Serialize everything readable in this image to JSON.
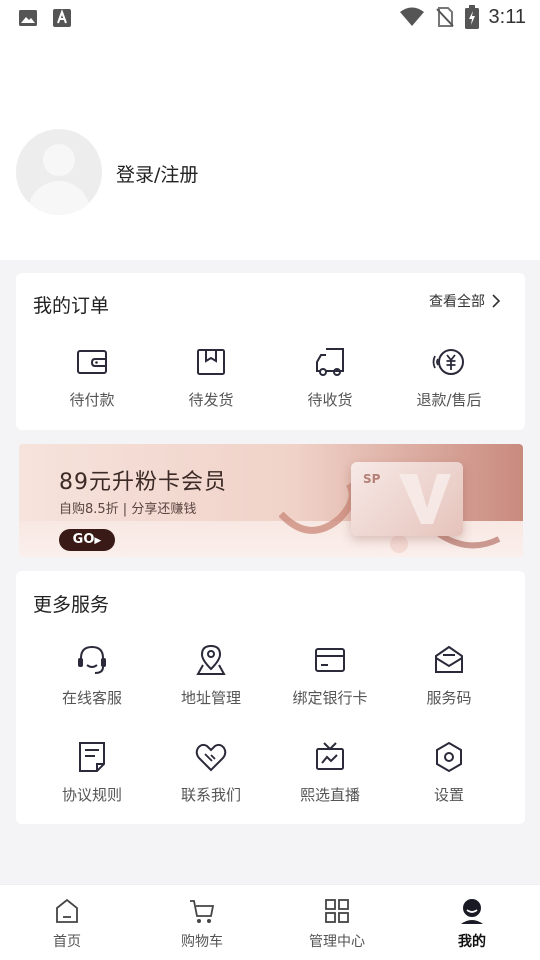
{
  "status_bar": {
    "time": "3:11",
    "icons": [
      "image-icon",
      "a-notification-icon",
      "wifi-icon",
      "no-sim-icon",
      "battery-icon"
    ]
  },
  "profile": {
    "login_label": "登录/注册"
  },
  "orders": {
    "title": "我的订单",
    "view_all": "查看全部",
    "items": [
      {
        "label": "待付款",
        "icon": "wallet-icon"
      },
      {
        "label": "待发货",
        "icon": "package-icon"
      },
      {
        "label": "待收货",
        "icon": "truck-icon"
      },
      {
        "label": "退款/售后",
        "icon": "refund-icon"
      }
    ]
  },
  "banner": {
    "title": "89元升粉卡会员",
    "subtitle": "自购8.5折 | 分享还赚钱",
    "go_label": "GO",
    "card_label": "SP"
  },
  "services": {
    "title": "更多服务",
    "items": [
      {
        "label": "在线客服",
        "icon": "headset-icon"
      },
      {
        "label": "地址管理",
        "icon": "location-icon"
      },
      {
        "label": "绑定银行卡",
        "icon": "bank-card-icon"
      },
      {
        "label": "服务码",
        "icon": "mail-open-icon"
      },
      {
        "label": "协议规则",
        "icon": "document-icon"
      },
      {
        "label": "联系我们",
        "icon": "heart-handshake-icon"
      },
      {
        "label": "熙选直播",
        "icon": "tv-live-icon"
      },
      {
        "label": "设置",
        "icon": "settings-hexagon-icon"
      }
    ]
  },
  "tab_bar": {
    "active_index": 3,
    "items": [
      {
        "label": "首页",
        "icon": "home-icon"
      },
      {
        "label": "购物车",
        "icon": "cart-icon"
      },
      {
        "label": "管理中心",
        "icon": "grid-icon"
      },
      {
        "label": "我的",
        "icon": "user-icon"
      }
    ]
  },
  "colors": {
    "icon_stroke": "#2a2a3a",
    "banner_go_bg": "#3a1a16",
    "page_bg": "#f4f4f6"
  }
}
